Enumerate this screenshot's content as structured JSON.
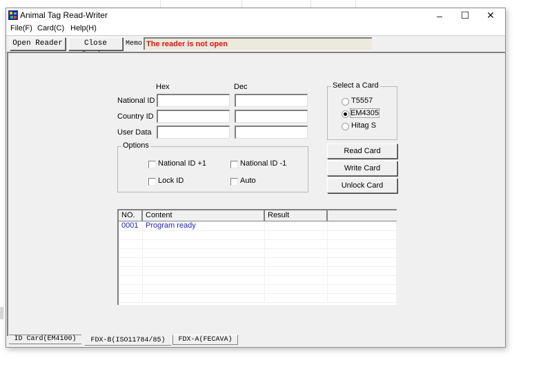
{
  "window": {
    "title": "Animal Tag Read-Writer",
    "controls": {
      "minimize": "–",
      "maximize": "☐",
      "close": "✕"
    }
  },
  "menu": [
    {
      "label": "File(F)"
    },
    {
      "label": "Card(C)"
    },
    {
      "label": "Help(H)"
    }
  ],
  "toolbar": {
    "open_reader": "Open Reader",
    "close_reader": "Close Reader",
    "memo_label": "Memo",
    "memo_text": "The reader is not open",
    "memo_color": "#e01010"
  },
  "form": {
    "col_hex": "Hex",
    "col_dec": "Dec",
    "rows": [
      {
        "label": "National ID",
        "hex": "",
        "dec": ""
      },
      {
        "label": "Country ID",
        "hex": "",
        "dec": ""
      },
      {
        "label": "User Data",
        "hex": "",
        "dec": ""
      }
    ]
  },
  "select_card": {
    "title": "Select a Card",
    "options": [
      {
        "label": "T5557",
        "selected": false
      },
      {
        "label": "EM4305",
        "selected": true
      },
      {
        "label": "Hitag S",
        "selected": false
      }
    ]
  },
  "options": {
    "title": "Options",
    "items": [
      {
        "label": "National ID +1",
        "checked": false
      },
      {
        "label": "National ID -1",
        "checked": false
      },
      {
        "label": "Lock ID",
        "checked": false
      },
      {
        "label": "Auto",
        "checked": false
      }
    ]
  },
  "actions": {
    "read": "Read Card",
    "write": "Write Card",
    "unlock": "Unlock Card"
  },
  "log": {
    "columns": [
      "NO.",
      "Content",
      "Result",
      ""
    ],
    "rows": [
      {
        "no": "0001",
        "content": "Program ready",
        "result": ""
      }
    ],
    "text_color": "#2020d0"
  },
  "tabs": [
    {
      "label": "ID Card(EM4100)",
      "active": false
    },
    {
      "label": "FDX-B(ISO11784/85)",
      "active": true
    },
    {
      "label": "FDX-A(FECAVA)",
      "active": false
    }
  ]
}
